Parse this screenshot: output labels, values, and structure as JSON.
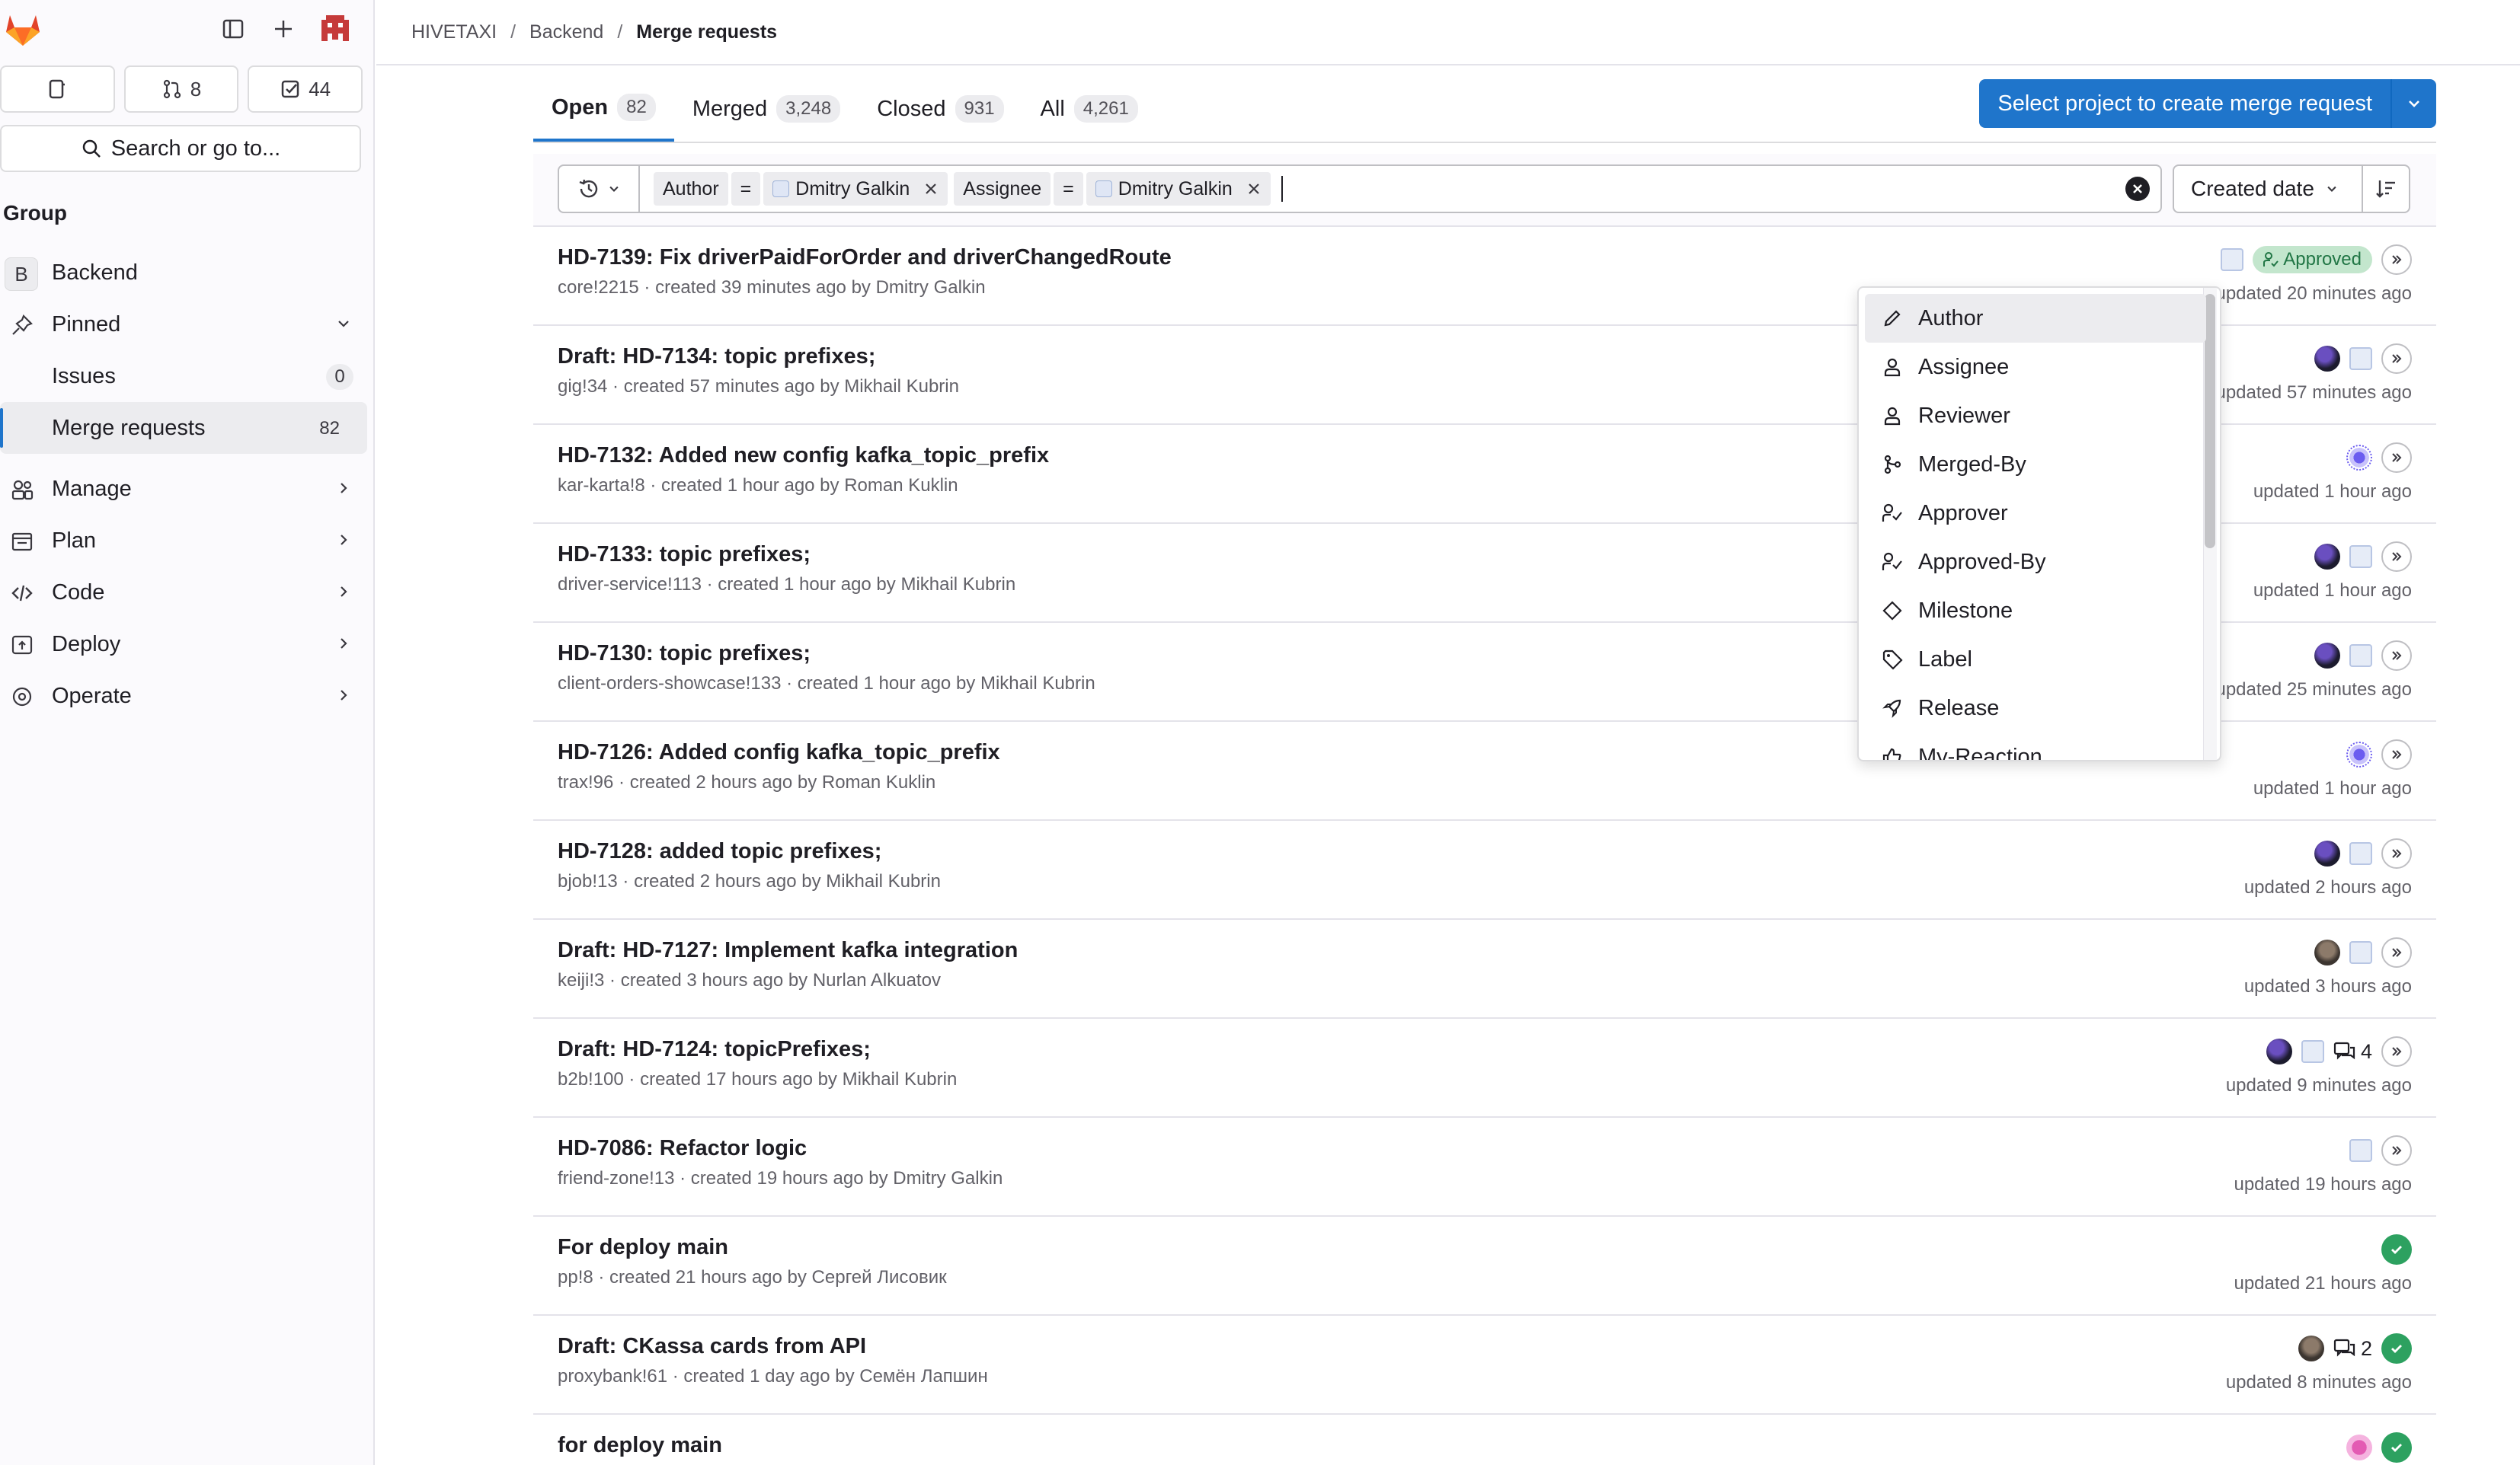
{
  "sidebar": {
    "counts": {
      "mr": "8",
      "todos": "44"
    },
    "search_label": "Search or go to...",
    "group_label": "Group",
    "context": {
      "initial": "B",
      "name": "Backend"
    },
    "pinned_label": "Pinned",
    "pinned_items": [
      {
        "label": "Issues",
        "count": "0"
      },
      {
        "label": "Merge requests",
        "count": "82"
      }
    ],
    "menu": [
      {
        "label": "Manage"
      },
      {
        "label": "Plan"
      },
      {
        "label": "Code"
      },
      {
        "label": "Deploy"
      },
      {
        "label": "Operate"
      }
    ]
  },
  "breadcrumb": {
    "root": "HIVETAXI",
    "group": "Backend",
    "current": "Merge requests"
  },
  "tabs": [
    {
      "label": "Open",
      "count": "82"
    },
    {
      "label": "Merged",
      "count": "3,248"
    },
    {
      "label": "Closed",
      "count": "931"
    },
    {
      "label": "All",
      "count": "4,261"
    }
  ],
  "create_button": "Select project to create merge request",
  "filters": [
    {
      "field": "Author",
      "op": "=",
      "value": "Dmitry Galkin"
    },
    {
      "field": "Assignee",
      "op": "=",
      "value": "Dmitry Galkin"
    }
  ],
  "sort_label": "Created date",
  "dropdown_items": [
    {
      "label": "Author",
      "icon": "pencil-icon"
    },
    {
      "label": "Assignee",
      "icon": "user-icon"
    },
    {
      "label": "Reviewer",
      "icon": "user-icon"
    },
    {
      "label": "Merged-By",
      "icon": "merge-icon"
    },
    {
      "label": "Approver",
      "icon": "approver-icon"
    },
    {
      "label": "Approved-By",
      "icon": "approver-icon"
    },
    {
      "label": "Milestone",
      "icon": "milestone-icon"
    },
    {
      "label": "Label",
      "icon": "label-icon"
    },
    {
      "label": "Release",
      "icon": "rocket-icon"
    },
    {
      "label": "My-Reaction",
      "icon": "thumb-icon"
    }
  ],
  "approved_label": "Approved",
  "merge_requests": [
    {
      "title": "HD-7139: Fix driverPaidForOrder and driverChangedRoute",
      "meta": "core!2215 · created 39 minutes ago by Dmitry Galkin",
      "updated": "updated 20 minutes ago"
    },
    {
      "title": "Draft: HD-7134: topic prefixes;",
      "meta": "gig!34 · created 57 minutes ago by Mikhail Kubrin",
      "updated": "updated 57 minutes ago"
    },
    {
      "title": "HD-7132: Added new config kafka_topic_prefix",
      "meta": "kar-karta!8 · created 1 hour ago by Roman Kuklin",
      "updated": "updated 1 hour ago"
    },
    {
      "title": "HD-7133: topic prefixes;",
      "meta": "driver-service!113 · created 1 hour ago by Mikhail Kubrin",
      "updated": "updated 1 hour ago"
    },
    {
      "title": "HD-7130: topic prefixes;",
      "meta": "client-orders-showcase!133 · created 1 hour ago by Mikhail Kubrin",
      "updated": "updated 25 minutes ago"
    },
    {
      "title": "HD-7126: Added config kafka_topic_prefix",
      "meta": "trax!96 · created 2 hours ago by Roman Kuklin",
      "updated": "updated 1 hour ago"
    },
    {
      "title": "HD-7128: added topic prefixes;",
      "meta": "bjob!13 · created 2 hours ago by Mikhail Kubrin",
      "updated": "updated 2 hours ago"
    },
    {
      "title": "Draft: HD-7127: Implement kafka integration",
      "meta": "keiji!3 · created 3 hours ago by Nurlan Alkuatov",
      "updated": "updated 3 hours ago"
    },
    {
      "title": "Draft: HD-7124: topicPrefixes;",
      "meta": "b2b!100 · created 17 hours ago by Mikhail Kubrin",
      "updated": "updated 9 minutes ago",
      "comments": "4"
    },
    {
      "title": "HD-7086: Refactor logic",
      "meta": "friend-zone!13 · created 19 hours ago by Dmitry Galkin",
      "updated": "updated 19 hours ago"
    },
    {
      "title": "For deploy main",
      "meta": "pp!8 · created 21 hours ago by Сергей Лисовик",
      "updated": "updated 21 hours ago"
    },
    {
      "title": "Draft: CKassa cards from API",
      "meta": "proxybank!61 · created 1 day ago by Семён Лапшин",
      "updated": "updated 8 minutes ago",
      "comments": "2"
    },
    {
      "title": "for deploy main",
      "meta": "",
      "updated": ""
    }
  ]
}
